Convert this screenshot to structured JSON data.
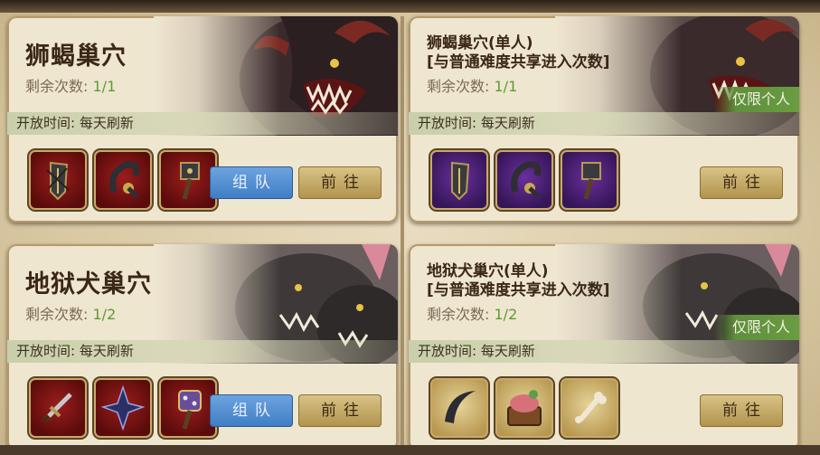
{
  "cards": [
    {
      "title": "狮蝎巢穴",
      "remain_label": "剩余次数:",
      "remain_value": "1/1",
      "open_time": "开放时间: 每天刷新",
      "team_button": "组队",
      "go_button": "前往",
      "item_rarity": "red",
      "items": [
        "spiked-shield-icon",
        "spiked-hook-icon",
        "spiked-hammer-icon"
      ]
    },
    {
      "title_line1": "狮蝎巢穴(单人)",
      "title_line2": "[与普通难度共享进入次数]",
      "remain_label": "剩余次数:",
      "remain_value": "1/1",
      "badge": "仅限个人",
      "open_time": "开放时间: 每天刷新",
      "go_button": "前往",
      "item_rarity": "purple",
      "items": [
        "spiked-shield-icon",
        "spiked-hook-icon",
        "spiked-hammer-icon"
      ]
    },
    {
      "title": "地狱犬巢穴",
      "remain_label": "剩余次数:",
      "remain_value": "1/2",
      "open_time": "开放时间: 每天刷新",
      "team_button": "组队",
      "go_button": "前往",
      "item_rarity": "red",
      "items": [
        "cross-sword-icon",
        "star-blade-icon",
        "studded-hammer-icon"
      ]
    },
    {
      "title_line1": "地狱犬巢穴(单人)",
      "title_line2": "[与普通难度共享进入次数]",
      "remain_label": "剩余次数:",
      "remain_value": "1/2",
      "badge": "仅限个人",
      "open_time": "开放时间: 每天刷新",
      "go_button": "前往",
      "item_rarity": "gold",
      "items": [
        "crescent-claw-icon",
        "meat-chest-icon",
        "bone-icon"
      ]
    }
  ],
  "colors": {
    "remain_value": "#5f9a34",
    "team_button": "#4a86cc",
    "go_button": "#c6ab68",
    "badge": "#5f8f3c"
  }
}
